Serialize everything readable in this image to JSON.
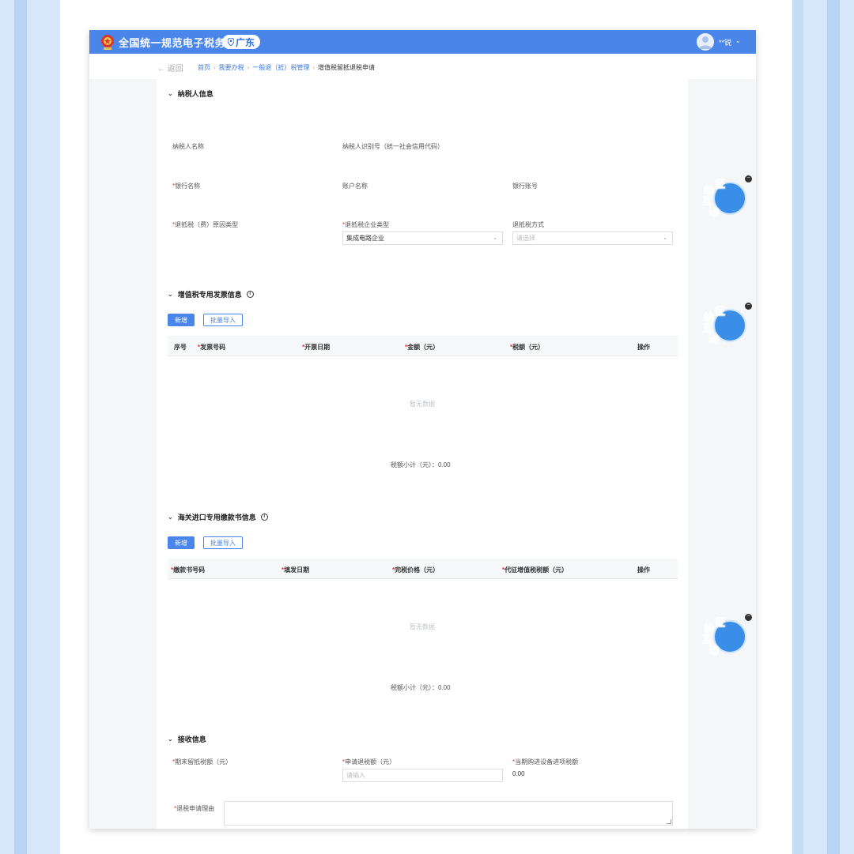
{
  "header": {
    "site_title": "全国统一规范电子税务局",
    "region": "广东",
    "user_name": "**锐",
    "user_caret": "⌄"
  },
  "breadcrumb": {
    "back": "← 返回",
    "items": [
      "首页",
      "我要办税",
      "一般退（抵）税管理"
    ],
    "separator": "›",
    "current": "增值税留抵退税申请"
  },
  "taxpayer": {
    "title": "纳税人信息",
    "name_label": "纳税人名称",
    "id_label": "纳税人识别号（统一社会信用代码）",
    "bank_name_label": "银行名称",
    "account_name_label": "账户名称",
    "account_no_label": "银行账号",
    "reason_label": "退抵税（费）原因类型",
    "enterprise_type_label": "退抵税企业类型",
    "enterprise_type_value": "集成电路企业",
    "refund_method_label": "退抵税方式",
    "refund_method_placeholder": "请选择",
    "required_mark": "*"
  },
  "vat_invoice": {
    "title": "增值税专用发票信息",
    "add_button": "新增",
    "import_button": "批量导入",
    "columns": [
      "序号",
      "发票号码",
      "开票日期",
      "金额（元）",
      "税额（元）",
      "操作"
    ],
    "empty": "暂无数据",
    "subtotal": "税额小计（元）：0.00"
  },
  "customs": {
    "title": "海关进口专用缴款书信息",
    "add_button": "新增",
    "import_button": "批量导入",
    "columns": [
      "缴款书号码",
      "填发日期",
      "完税价格（元）",
      "代征增值税税额（元）",
      "操作"
    ],
    "empty": "暂无数据",
    "subtotal": "税额小计（元）：0.00"
  },
  "receive": {
    "title": "接收信息",
    "end_balance_label": "期末留抵税额（元）",
    "apply_amount_label": "申请退税额（元）",
    "apply_amount_placeholder": "请输入",
    "equipment_label": "当期购进设备进项税额",
    "equipment_value": "0.00",
    "reason_label": "退税申请理由"
  },
  "widget": {
    "chars": [
      "纳",
      "征",
      "互",
      "动"
    ],
    "close": "−"
  },
  "colors": {
    "brand": "#4a86ea",
    "required": "#e4393c",
    "background": "#d6e6fb"
  }
}
